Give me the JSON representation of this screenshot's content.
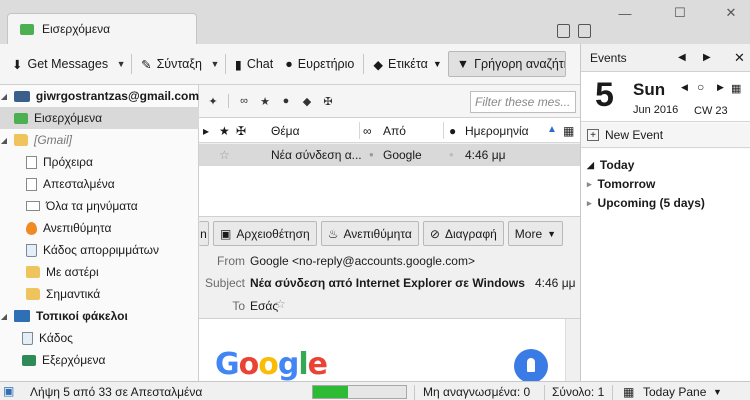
{
  "tab": {
    "title": "Εισερχόμενα"
  },
  "toolbar": {
    "get_messages": "Get Messages",
    "compose": "Σύνταξη",
    "chat": "Chat",
    "address_book": "Ευρετήριο",
    "tag": "Ετικέτα",
    "quick_filter": "Γρήγορη αναζήτηση"
  },
  "folders": {
    "account": "giwrgostrantzas@gmail.com",
    "inbox": "Εισερχόμενα",
    "gmail": "[Gmail]",
    "drafts": "Πρόχειρα",
    "sent": "Απεσταλμένα",
    "all_mail": "Όλα τα μηνύματα",
    "important": "Ανεπιθύμητα",
    "trash_gmail": "Κάδος απορριμμάτων",
    "starred": "Με αστέρι",
    "flagged": "Σημαντικά",
    "local": "Τοπικοί φάκελοι",
    "trash": "Κάδος",
    "outbox": "Εξερχόμενα"
  },
  "thread": {
    "filter_placeholder": "Filter these mes...",
    "col_subject": "Θέμα",
    "col_from": "Από",
    "col_date": "Ημερομηνία",
    "row_subject": "Νέα σύνδεση α...",
    "row_from": "Google",
    "row_date": "4:46 μμ"
  },
  "msg_tools": {
    "archive": "Αρχειοθέτηση",
    "junk": "Ανεπιθύμητα",
    "delete": "Διαγραφή",
    "more": "More"
  },
  "msg": {
    "from_label": "From",
    "from": "Google <no-reply@accounts.google.com>",
    "subject_label": "Subject",
    "subject": "Νέα σύνδεση από Internet Explorer σε Windows",
    "time": "4:46 μμ",
    "to_label": "To",
    "to": "Εσάς",
    "logo": "Google"
  },
  "events": {
    "title": "Events",
    "day": "5",
    "weekday": "Sun",
    "month_year": "Jun 2016",
    "cw": "CW 23",
    "new_event": "New Event",
    "today": "Today",
    "tomorrow": "Tomorrow",
    "upcoming": "Upcoming (5 days)"
  },
  "status": {
    "text": "Λήψη 5 από 33 σε Απεσταλμένα",
    "progress": 0.38,
    "unread": "Μη αναγνωσμένα: 0",
    "total": "Σύνολο: 1",
    "today_pane": "Today Pane"
  },
  "colors": {
    "accent_blue": "#3b7be6",
    "progress_green": "#2dbb35",
    "selected_row": "#d9d9d9"
  }
}
